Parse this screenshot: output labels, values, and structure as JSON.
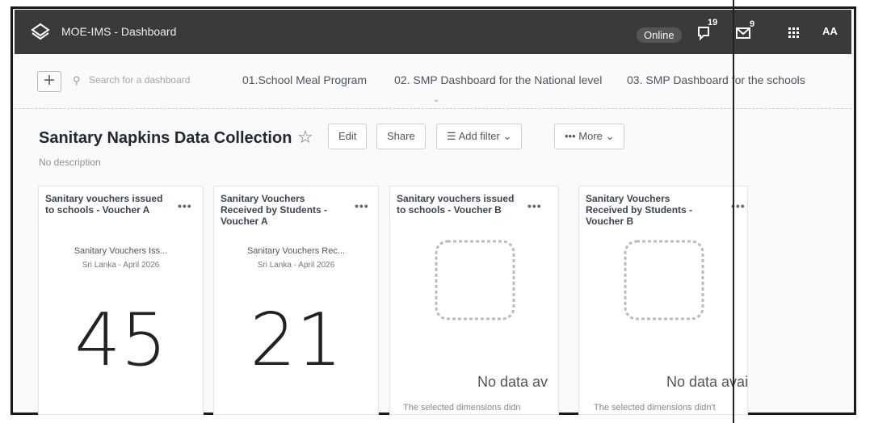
{
  "app": {
    "title": "MOE-IMS - Dashboard",
    "status": "Online",
    "interpretation_badge": "19",
    "messages_badge": "9",
    "user_initials": "AA"
  },
  "nav": {
    "search_placeholder": "Search for a dashboard",
    "tabs": [
      {
        "label": "01.School Meal Program"
      },
      {
        "label": "02. SMP Dashboard for the National level"
      },
      {
        "label": "03. SMP Dashboard for the schools"
      }
    ]
  },
  "dashboard": {
    "title": "Sanitary Napkins Data Collection",
    "description": "No description",
    "edit_label": "Edit",
    "share_label": "Share",
    "add_filter_label": "Add filter",
    "more_label": "More"
  },
  "cards": [
    {
      "title": "Sanitary vouchers issued to schools - Voucher A",
      "subtitle": "Sanitary Vouchers Iss...",
      "meta": "Sri Lanka - April 2026",
      "value": "45"
    },
    {
      "title": "Sanitary Vouchers Received by Students - Voucher A",
      "subtitle": "Sanitary Vouchers Rec...",
      "meta": "Sri Lanka - April 2026",
      "value": "21"
    },
    {
      "title": "Sanitary vouchers issued to schools - Voucher B",
      "nodata_title": "No data av",
      "nodata_desc": "The selected dimensions didn"
    },
    {
      "title": "Sanitary Vouchers Received by Students - Voucher B",
      "nodata_title": "No data avai",
      "nodata_desc": "The selected dimensions didn't"
    }
  ]
}
